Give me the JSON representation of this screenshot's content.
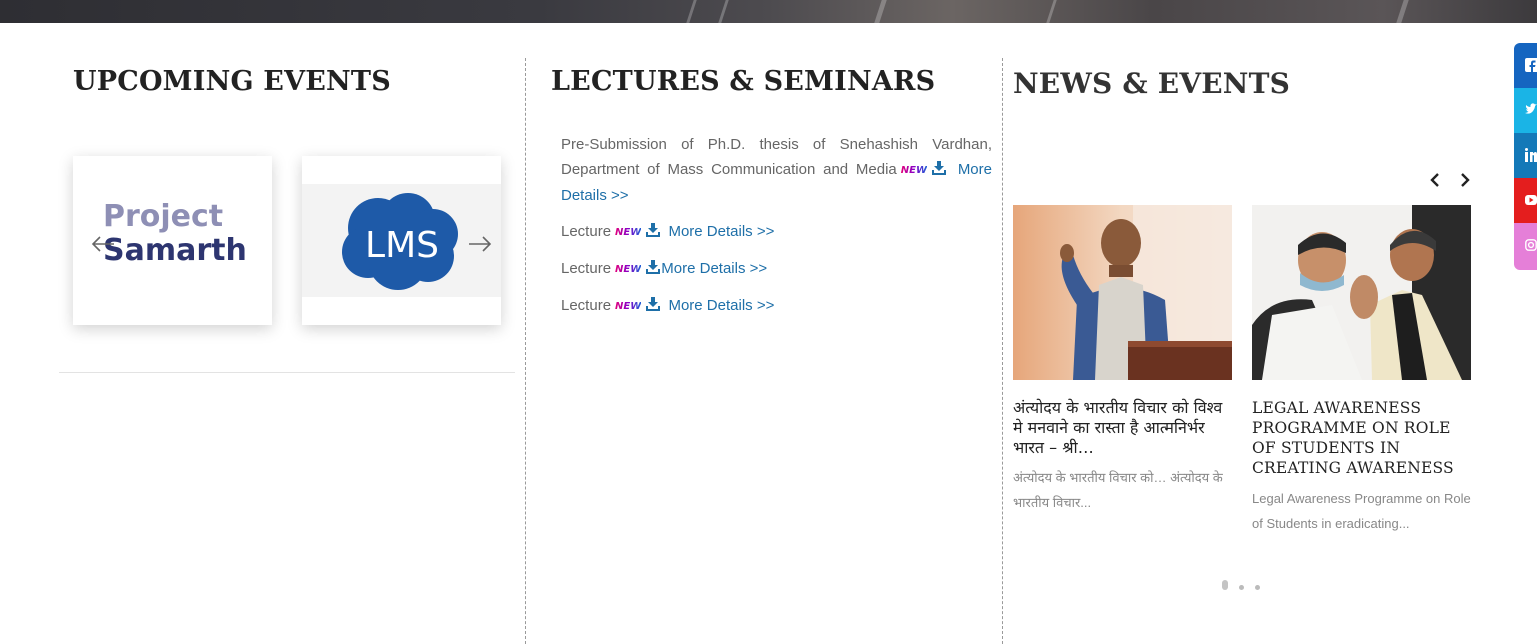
{
  "upcoming_events": {
    "title": "UPCOMING EVENTS",
    "cards": [
      {
        "logo_line1": "Project",
        "logo_line2": "Samarth"
      },
      {
        "logo_text": "LMS"
      }
    ]
  },
  "lectures": {
    "title": "LECTURES & SEMINARS",
    "items": [
      {
        "text": "Pre-Submission of Ph.D. thesis of Snehashish Vardhan, Department of Mass Communication and Media",
        "badge": "NEW",
        "link": "More Details >>"
      },
      {
        "text": "Lecture",
        "badge": "NEW",
        "link": "More Details >>"
      },
      {
        "text": "Lecture",
        "badge": "NEW",
        "link": "More Details >>"
      },
      {
        "text": "Lecture",
        "badge": "NEW",
        "link": "More Details >>"
      }
    ]
  },
  "news": {
    "title": "NEWS & EVENTS",
    "items": [
      {
        "title": "अंत्योदय के भारतीय विचार को विश्व मे मनवाने का रास्ता है आत्मनिर्भर भारत – श्री…",
        "excerpt": "अंत्योदय के भारतीय विचार को… अंत्योदय के भारतीय विचार..."
      },
      {
        "title": "LEGAL AWARENESS PROGRAMME ON ROLE OF STUDENTS IN CREATING AWARENESS",
        "excerpt": "Legal Awareness Programme on Role of Students in eradicating..."
      }
    ]
  },
  "social": [
    {
      "icon": "facebook-icon",
      "color": "#1565c0"
    },
    {
      "icon": "twitter-icon",
      "color": "#1ab4e6"
    },
    {
      "icon": "linkedin-icon",
      "color": "#1479b8"
    },
    {
      "icon": "youtube-icon",
      "color": "#e41e1e"
    },
    {
      "icon": "instagram-icon",
      "color": "#e57fd8"
    }
  ],
  "colors": {
    "link": "#1e6fa8",
    "title": "#222222",
    "body_text": "#666666"
  }
}
